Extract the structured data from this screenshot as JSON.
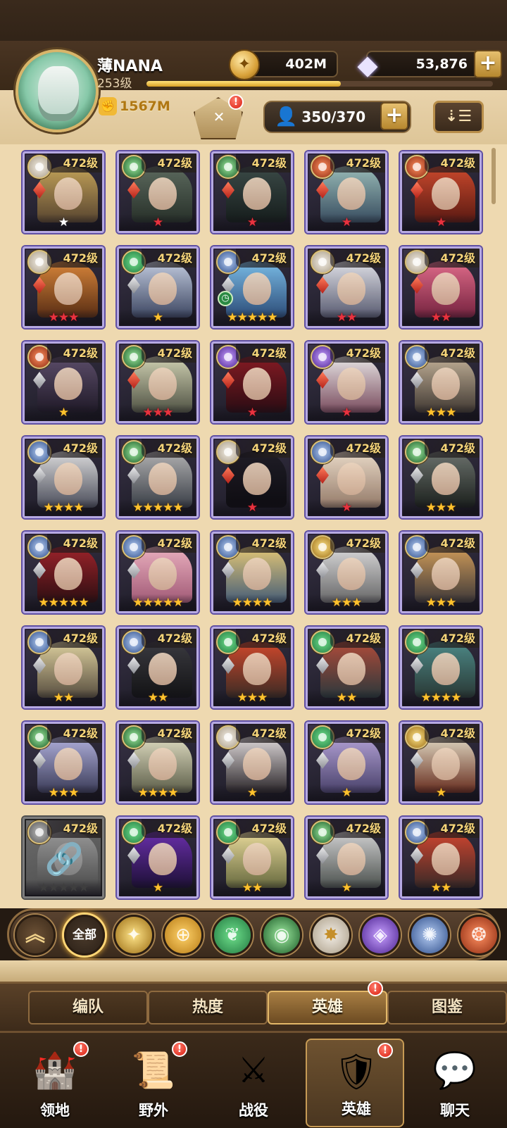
{
  "player": {
    "name": "薄NANA",
    "level": "253级",
    "power": "1567M",
    "exp_fraction": 0.56
  },
  "resources": {
    "gold": "402M",
    "gems": "53,876",
    "plus": "+"
  },
  "hero_count": "350/370",
  "heroes": [
    {
      "level": "472级",
      "stars": "★",
      "star_color": "white",
      "faction": "dimensional"
    },
    {
      "level": "472级",
      "stars": "★",
      "star_color": "red",
      "faction": "graveborn"
    },
    {
      "level": "472级",
      "stars": "★",
      "star_color": "red",
      "faction": "graveborn"
    },
    {
      "level": "472级",
      "stars": "★",
      "star_color": "red",
      "faction": "mauler"
    },
    {
      "level": "472级",
      "stars": "★",
      "star_color": "red",
      "faction": "mauler"
    },
    {
      "level": "472级",
      "stars": "★★★",
      "star_color": "red",
      "faction": "dimensional"
    },
    {
      "level": "472级",
      "stars": "★",
      "star_color": "gold",
      "faction": "wilder"
    },
    {
      "level": "472级",
      "stars": "★★★★★",
      "star_color": "gold",
      "faction": "celestial"
    },
    {
      "level": "472级",
      "stars": "★★",
      "star_color": "red",
      "faction": "dimensional"
    },
    {
      "level": "472级",
      "stars": "★★",
      "star_color": "red",
      "faction": "dimensional"
    },
    {
      "level": "472级",
      "stars": "★",
      "star_color": "gold",
      "faction": "mauler"
    },
    {
      "level": "472级",
      "stars": "★★★",
      "star_color": "red",
      "faction": "graveborn"
    },
    {
      "level": "472级",
      "stars": "★",
      "star_color": "red",
      "faction": "hypogean"
    },
    {
      "level": "472级",
      "stars": "★",
      "star_color": "red",
      "faction": "hypogean"
    },
    {
      "level": "472级",
      "stars": "★★★",
      "star_color": "gold",
      "faction": "celestial"
    },
    {
      "level": "472级",
      "stars": "★★★★",
      "star_color": "gold",
      "faction": "celestial"
    },
    {
      "level": "472级",
      "stars": "★★★★★",
      "star_color": "gold",
      "faction": "graveborn"
    },
    {
      "level": "472级",
      "stars": "★",
      "star_color": "red",
      "faction": "dimensional"
    },
    {
      "level": "472级",
      "stars": "★",
      "star_color": "red",
      "faction": "celestial"
    },
    {
      "level": "472级",
      "stars": "★★★",
      "star_color": "gold",
      "faction": "graveborn"
    },
    {
      "level": "472级",
      "stars": "★★★★★",
      "star_color": "gold",
      "faction": "celestial"
    },
    {
      "level": "472级",
      "stars": "★★★★★",
      "star_color": "gold",
      "faction": "celestial"
    },
    {
      "level": "472级",
      "stars": "★★★★",
      "star_color": "gold",
      "faction": "celestial"
    },
    {
      "level": "472级",
      "stars": "★★★",
      "star_color": "gold",
      "faction": "lightbearer"
    },
    {
      "level": "472级",
      "stars": "★★★",
      "star_color": "gold",
      "faction": "celestial"
    },
    {
      "level": "472级",
      "stars": "★★",
      "star_color": "gold",
      "faction": "celestial"
    },
    {
      "level": "472级",
      "stars": "★★",
      "star_color": "gold",
      "faction": "celestial"
    },
    {
      "level": "472级",
      "stars": "★★★",
      "star_color": "gold",
      "faction": "wilder"
    },
    {
      "level": "472级",
      "stars": "★★",
      "star_color": "gold",
      "faction": "wilder"
    },
    {
      "level": "472级",
      "stars": "★★★★",
      "star_color": "gold",
      "faction": "wilder"
    },
    {
      "level": "472级",
      "stars": "★★★",
      "star_color": "gold",
      "faction": "graveborn"
    },
    {
      "level": "472级",
      "stars": "★★★★",
      "star_color": "gold",
      "faction": "graveborn"
    },
    {
      "level": "472级",
      "stars": "★",
      "star_color": "gold",
      "faction": "dimensional"
    },
    {
      "level": "472级",
      "stars": "★",
      "star_color": "gold",
      "faction": "wilder"
    },
    {
      "level": "472级",
      "stars": "★",
      "star_color": "gold",
      "faction": "lightbearer"
    },
    {
      "level": "472级",
      "stars": "★★★★★",
      "star_color": "gray",
      "faction": "locked"
    },
    {
      "level": "472级",
      "stars": "★",
      "star_color": "gold",
      "faction": "wilder"
    },
    {
      "level": "472级",
      "stars": "★★",
      "star_color": "gold",
      "faction": "wilder"
    },
    {
      "level": "472级",
      "stars": "★",
      "star_color": "gold",
      "faction": "graveborn"
    },
    {
      "level": "472级",
      "stars": "★★",
      "star_color": "gold",
      "faction": "celestial"
    }
  ],
  "filters": {
    "all_label": "全部",
    "icons": [
      "up-arrow",
      "all",
      "lightbearer",
      "mauler",
      "wilder",
      "graveborn",
      "celestial",
      "hypogean",
      "dimensional",
      "fire"
    ]
  },
  "subtabs": [
    "编队",
    "热度",
    "英雄",
    "图鉴"
  ],
  "nav": [
    "领地",
    "野外",
    "战役",
    "英雄",
    "聊天"
  ],
  "badges": {
    "exclaim": "!"
  },
  "sort_label": "⇣☰"
}
